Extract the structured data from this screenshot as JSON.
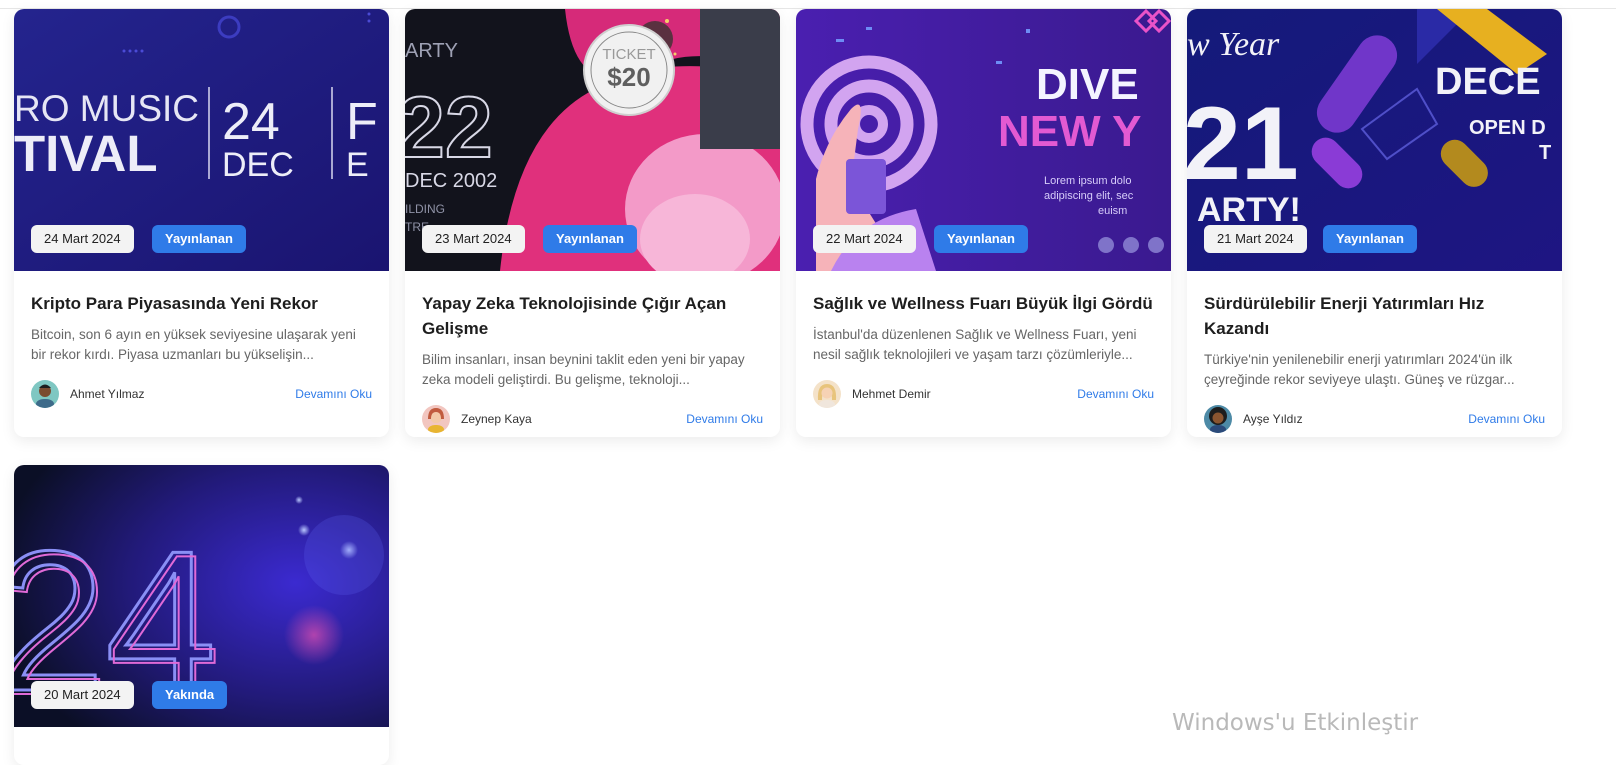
{
  "cards": [
    {
      "date": "24 Mart 2024",
      "status": "Yayınlanan",
      "title": "Kripto Para Piyasasında Yeni Rekor",
      "excerpt": "Bitcoin, son 6 ayın en yüksek seviyesine ulaşarak yeni bir rekor kırdı. Piyasa uzmanları bu yükselişin...",
      "author": "Ahmet Yılmaz",
      "read_more": "Devamını Oku",
      "image_text": [
        "RO MUSIC",
        "TIVAL",
        "24",
        "DEC",
        "F",
        "E"
      ]
    },
    {
      "date": "23 Mart 2024",
      "status": "Yayınlanan",
      "title": "Yapay Zeka Teknolojisinde Çığır Açan Gelişme",
      "excerpt": "Bilim insanları, insan beynini taklit eden yeni bir yapay zeka modeli geliştirdi. Bu gelişme, teknoloji...",
      "author": "Zeynep Kaya",
      "read_more": "Devamını Oku",
      "image_text": [
        "ARTY",
        "22",
        "DEC 2002",
        "TICKET",
        "$20",
        "ILDING",
        "TRE"
      ]
    },
    {
      "date": "22 Mart 2024",
      "status": "Yayınlanan",
      "title": "Sağlık ve Wellness Fuarı Büyük İlgi Gördü",
      "excerpt": "İstanbul'da düzenlenen Sağlık ve Wellness Fuarı, yeni nesil sağlık teknolojileri ve yaşam tarzı çözümleriyle...",
      "author": "Mehmet Demir",
      "read_more": "Devamını Oku",
      "image_text": [
        "DIVE",
        "NEW Y",
        "Lorem ipsum dolo",
        "adipiscing elit, sec",
        "euism"
      ]
    },
    {
      "date": "21 Mart 2024",
      "status": "Yayınlanan",
      "title": "Sürdürülebilir Enerji Yatırımları Hız Kazandı",
      "excerpt": "Türkiye'nin yenilenebilir enerji yatırımları 2024'ün ilk çeyreğinde rekor seviyeye ulaştı. Güneş ve rüzgar...",
      "author": "Ayşe Yıldız",
      "read_more": "Devamını Oku",
      "image_text": [
        "w Year",
        "21",
        "ARTY!",
        "DECE",
        "OPEN D",
        "T"
      ]
    },
    {
      "date": "20 Mart 2024",
      "status": "Yakında",
      "image_text": [
        "24"
      ]
    }
  ],
  "watermark": "Windows'u Etkinleştir",
  "colors": {
    "accent": "#2f7be8",
    "date_badge_bg": "#f3f3f3"
  }
}
